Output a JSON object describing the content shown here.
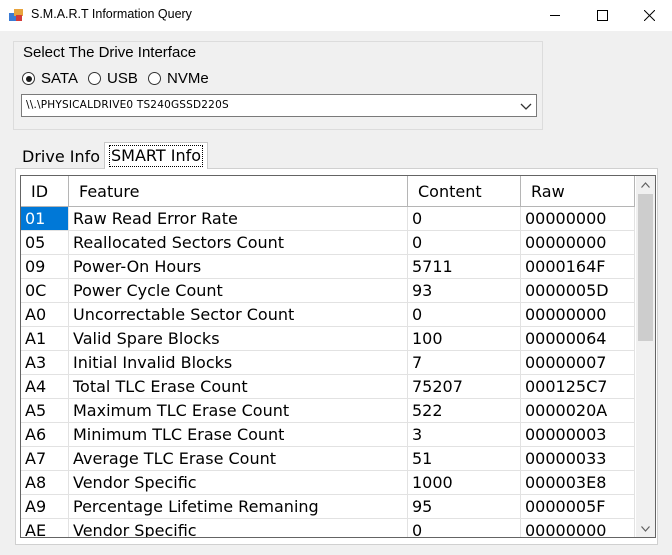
{
  "window": {
    "title": "S.M.A.R.T Information Query"
  },
  "interface_group": {
    "legend": "Select The Drive Interface",
    "options": [
      {
        "label": "SATA",
        "checked": true
      },
      {
        "label": "USB",
        "checked": false
      },
      {
        "label": "NVMe",
        "checked": false
      }
    ],
    "selected_drive": "\\\\.\\PHYSICALDRIVE0 TS240GSSD220S"
  },
  "tabs": [
    {
      "label": "Drive Info",
      "active": false
    },
    {
      "label": "SMART Info",
      "active": true
    }
  ],
  "table": {
    "columns": [
      "ID",
      "Feature",
      "Content",
      "Raw"
    ],
    "rows": [
      [
        "01",
        "Raw Read Error Rate",
        "0",
        "00000000"
      ],
      [
        "05",
        "Reallocated Sectors Count",
        "0",
        "00000000"
      ],
      [
        "09",
        "Power-On Hours",
        "5711",
        "0000164F"
      ],
      [
        "0C",
        "Power Cycle Count",
        "93",
        "0000005D"
      ],
      [
        "A0",
        "Uncorrectable Sector Count",
        "0",
        "00000000"
      ],
      [
        "A1",
        "Valid Spare Blocks",
        "100",
        "00000064"
      ],
      [
        "A3",
        "Initial Invalid Blocks",
        "7",
        "00000007"
      ],
      [
        "A4",
        "Total TLC Erase Count",
        "75207",
        "000125C7"
      ],
      [
        "A5",
        "Maximum TLC Erase Count",
        "522",
        "0000020A"
      ],
      [
        "A6",
        "Minimum TLC Erase Count",
        "3",
        "00000003"
      ],
      [
        "A7",
        "Average TLC Erase Count",
        "51",
        "00000033"
      ],
      [
        "A8",
        "Vendor Specific",
        "1000",
        "000003E8"
      ],
      [
        "A9",
        "Percentage Lifetime Remaning",
        "95",
        "0000005F"
      ],
      [
        "AE",
        "Vendor Specific",
        "0",
        "00000000"
      ]
    ],
    "selected_row": 0
  },
  "colors": {
    "selection": "#0078d7",
    "window_bg": "#f0f0f0"
  }
}
